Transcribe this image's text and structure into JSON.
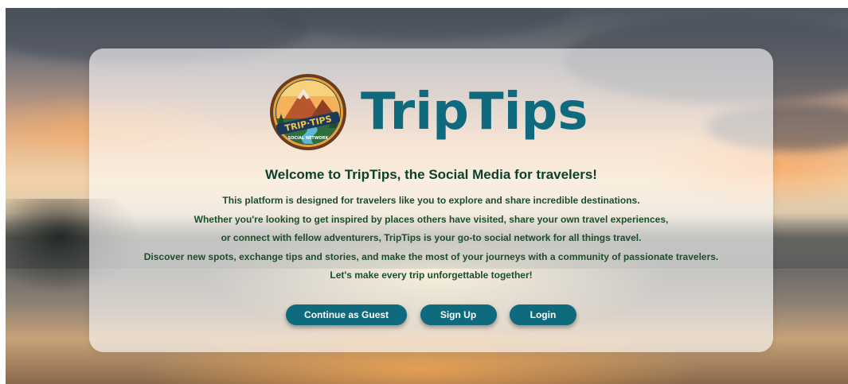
{
  "brand": {
    "name": "TripTips",
    "logo_icon": "triptips-mountain-lake-badge-icon",
    "logo_text_top": "TRIP·TIPS",
    "logo_text_bottom": "SOCIAL NETWORK"
  },
  "intro": {
    "headline": "Welcome to TripTips, the Social Media for travelers!",
    "paragraphs": [
      "This platform is designed for travelers like you to explore and share incredible destinations.",
      "Whether you're looking to get inspired by places others have visited, share your own travel experiences,",
      "or connect with fellow adventurers, TripTips is your go-to social network for all things travel.",
      "Discover new spots, exchange tips and stories, and make the most of your journeys with a community of passionate travelers.",
      "Let's make every trip unforgettable together!"
    ]
  },
  "actions": {
    "guest_label": "Continue as Guest",
    "signup_label": "Sign Up",
    "login_label": "Login"
  },
  "colors": {
    "brand_teal": "#0f6a7d",
    "text_green": "#1d4d2a",
    "button_text": "#ffffff"
  }
}
